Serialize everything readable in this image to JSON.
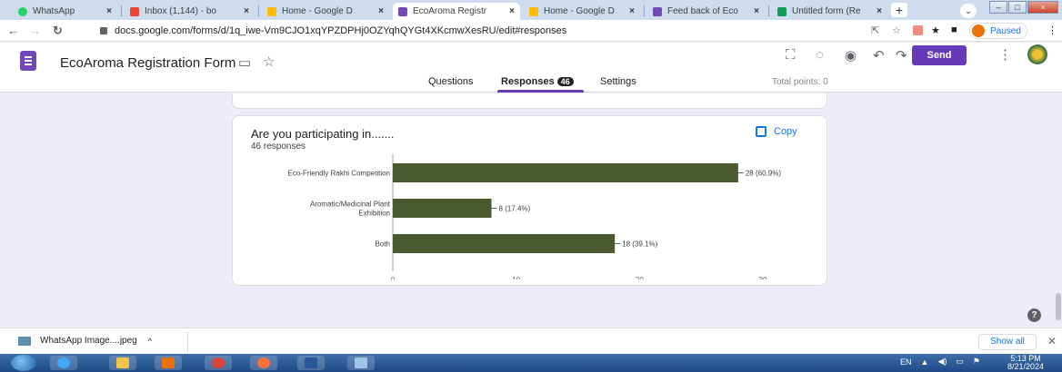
{
  "browser": {
    "tabs": [
      {
        "label": "WhatsApp",
        "favicon_color": "#25d366"
      },
      {
        "label": "Inbox (1,144) - bo",
        "favicon_color": "#ea4335"
      },
      {
        "label": "Home - Google D",
        "favicon_color": "#fbbc04"
      },
      {
        "label": "EcoAroma Registr",
        "favicon_color": "#7248b9",
        "active": true
      },
      {
        "label": "Home - Google D",
        "favicon_color": "#fbbc04"
      },
      {
        "label": "Feed back of Eco",
        "favicon_color": "#7248b9"
      },
      {
        "label": "Untitled form (Re",
        "favicon_color": "#0f9d58"
      }
    ],
    "new_tab": "+",
    "url": "docs.google.com/forms/d/1q_iwe-Vm9CJO1xqYPZDPHj0OZYqhQYGt4XKcmwXesRU/edit#responses",
    "profile_status": "Paused"
  },
  "form": {
    "title": "EcoAroma Registration Form",
    "send_label": "Send",
    "tabs": {
      "questions": "Questions",
      "responses": "Responses",
      "responses_count": "46",
      "settings": "Settings"
    },
    "total_points": "Total points: 0"
  },
  "question": {
    "title": "Are you participating in.......",
    "responses": "46 responses",
    "copy_label": "Copy"
  },
  "chart_data": {
    "type": "bar",
    "orientation": "horizontal",
    "categories": [
      [
        "Eco-Friendly Rakhi Competition"
      ],
      [
        "Aromatic/Medicinal Plant",
        "Exhibition"
      ],
      [
        "Both"
      ]
    ],
    "values": [
      28,
      8,
      18
    ],
    "value_labels": [
      "28 (60.9%)",
      "8 (17.4%)",
      "18 (39.1%)"
    ],
    "xlim": [
      0,
      30
    ],
    "xticks": [
      0,
      10,
      20,
      30
    ],
    "bar_color": "#4a5a2e",
    "grid": false
  },
  "downloads": {
    "file": "WhatsApp Image....jpeg",
    "show_all": "Show all"
  },
  "taskbar": {
    "lang": "EN",
    "time": "5:13 PM",
    "date": "8/21/2024"
  }
}
